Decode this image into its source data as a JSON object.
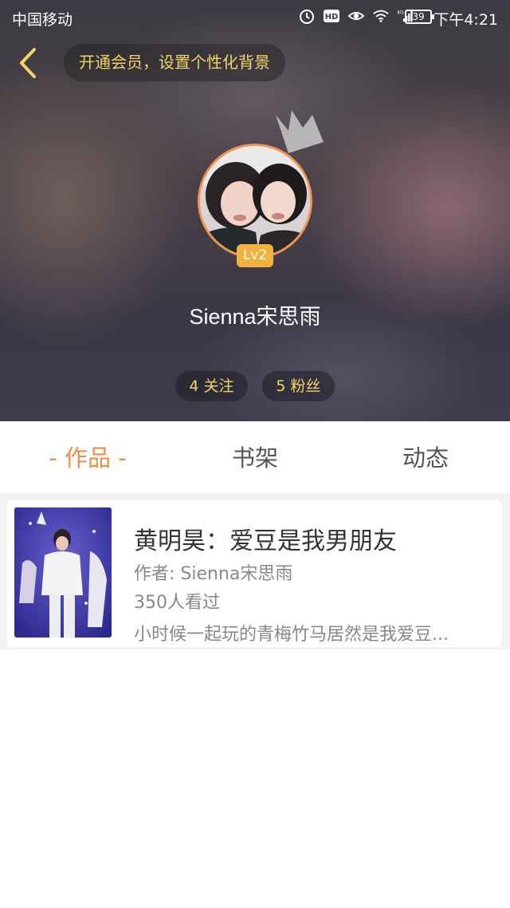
{
  "status_bar": {
    "carrier": "中国移动",
    "network": "4G",
    "battery": "39",
    "time": "下午4:21",
    "icons": [
      "alarm-icon",
      "hd-icon",
      "eye-icon",
      "wifi-icon",
      "signal-icon"
    ]
  },
  "header": {
    "back_icon": "chevron-left-icon",
    "vip_prompt": "开通会员，设置个性化背景",
    "level": "Lv2",
    "username": "Sienna宋思雨",
    "following": "4 关注",
    "fans": "5 粉丝"
  },
  "tabs": [
    {
      "label": "- 作品 -",
      "active": true
    },
    {
      "label": "书架",
      "active": false
    },
    {
      "label": "动态",
      "active": false
    }
  ],
  "works": [
    {
      "title": "黄明昊：爱豆是我男朋友",
      "author": "作者: Sienna宋思雨",
      "views": "350人看过",
      "description": "小时候一起玩的青梅竹马居然是我爱豆..."
    }
  ],
  "colors": {
    "accent": "#f08d48",
    "gold_text": "#f3d36a",
    "level_badge": "#f4b13e"
  }
}
